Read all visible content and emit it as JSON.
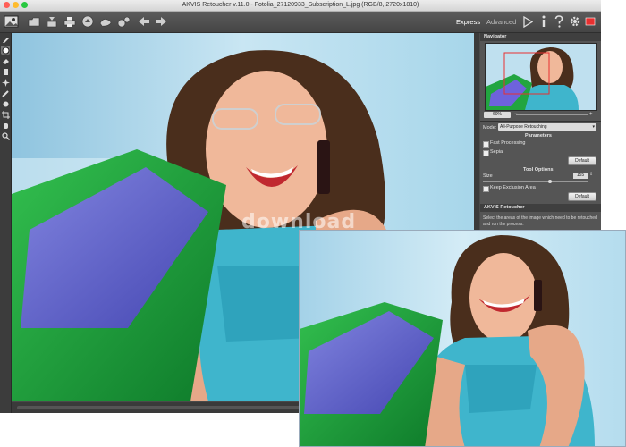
{
  "window": {
    "title": "AKVIS Retoucher v.11.0 - Fotolia_27120933_Subscription_L.jpg (RGB/8, 2720x1810)"
  },
  "toolbar": {
    "modes": {
      "express": "Express",
      "advanced": "Advanced"
    },
    "icons": [
      "photo-logo-icon",
      "open-icon",
      "save-icon",
      "print-icon",
      "share-icon",
      "presets-icon",
      "settings-icon",
      "undo-icon",
      "redo-icon",
      "run-icon",
      "info-icon",
      "help-icon",
      "preferences-icon",
      "flag-icon"
    ]
  },
  "navigator": {
    "title": "Navigator",
    "zoom": "60%"
  },
  "mode": {
    "label": "Mode:",
    "value": "All-Purpose Retouching"
  },
  "parameters": {
    "title": "Parameters",
    "fast_processing": "Fast Processing",
    "sepia": "Sepia",
    "default_label": "Default"
  },
  "tool_options": {
    "title": "Tool Options",
    "size_label": "Size",
    "size_value": "155",
    "keep_exclusion": "Keep Exclusion Area",
    "default_label": "Default"
  },
  "help": {
    "title": "AKVIS Retoucher",
    "text": "Select the areas of the image which need to be retouched and run the process."
  },
  "watermark": "download",
  "colors": {
    "accent": "#e83030",
    "toolbar_bg": "#4a4a4a",
    "panel_bg": "#555555"
  }
}
